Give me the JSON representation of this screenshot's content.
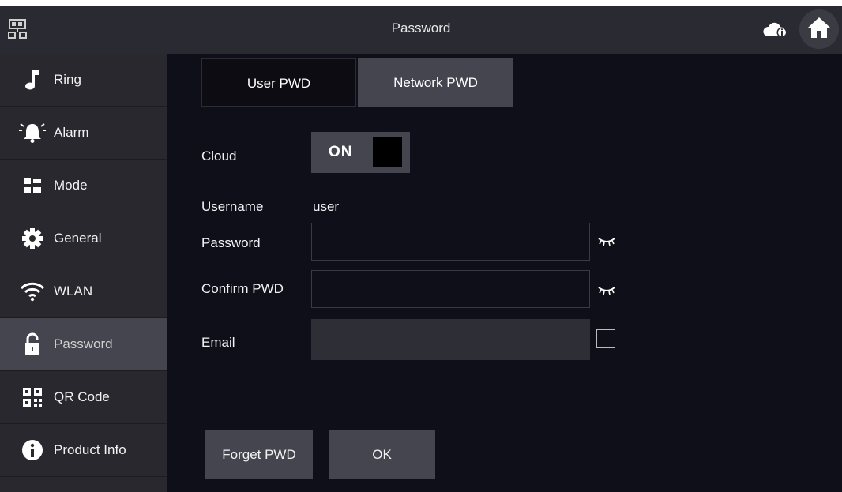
{
  "header": {
    "title": "Password",
    "icons": [
      "network-icon",
      "cloud-info-icon",
      "home-icon"
    ]
  },
  "sidebar": {
    "items": [
      {
        "label": "Ring",
        "icon": "music-note-icon"
      },
      {
        "label": "Alarm",
        "icon": "alarm-bell-icon"
      },
      {
        "label": "Mode",
        "icon": "mode-grid-icon"
      },
      {
        "label": "General",
        "icon": "gear-icon"
      },
      {
        "label": "WLAN",
        "icon": "wifi-icon"
      },
      {
        "label": "Password",
        "icon": "lock-icon",
        "active": true
      },
      {
        "label": "QR Code",
        "icon": "qr-code-icon"
      },
      {
        "label": "Product Info",
        "icon": "info-icon"
      }
    ]
  },
  "tabs": [
    {
      "label": "User PWD",
      "active": false
    },
    {
      "label": "Network PWD",
      "active": true
    }
  ],
  "form": {
    "cloud_label": "Cloud",
    "cloud_toggle": "ON",
    "username_label": "Username",
    "username_value": "user",
    "password_label": "Password",
    "password_value": "",
    "confirm_label": "Confirm PWD",
    "confirm_value": "",
    "email_label": "Email",
    "email_value": "",
    "email_checked": false
  },
  "buttons": {
    "forget": "Forget PWD",
    "ok": "OK"
  },
  "colors": {
    "background": "#0f0f1a",
    "panel": "#45454f",
    "sidebar": "#28282e",
    "topbar": "#2a2a33"
  }
}
